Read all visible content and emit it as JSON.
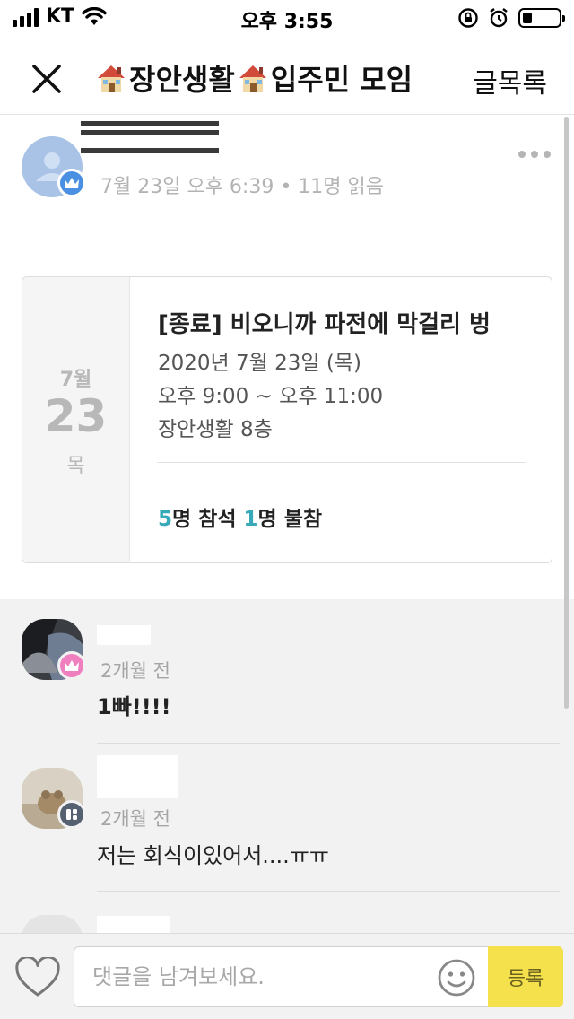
{
  "status_bar": {
    "carrier": "KT",
    "time": "오후 3:55",
    "icons": [
      "signal-icon",
      "wifi-icon",
      "rotation-lock-icon",
      "alarm-icon",
      "battery-icon"
    ]
  },
  "header": {
    "title": "장안생활",
    "title_part2": "입주민 모임",
    "list_button": "글목록",
    "icons": [
      "close-icon",
      "house-emoji-icon"
    ]
  },
  "post": {
    "meta": "7월 23일 오후 6:39 • 11명 읽음",
    "icons": [
      "user-avatar-icon",
      "crown-icon",
      "more-icon"
    ]
  },
  "event": {
    "month": "7월",
    "day": "23",
    "weekday": "목",
    "title": "[종료] 비오니까 파전에 막걸리 벙",
    "date_line": "2020년 7월 23일 (목)",
    "time_line": "오후 9:00 ~ 오후 11:00",
    "location_line": "장안생활 8층",
    "attend_count": "5",
    "attend_label": "명 참석 ",
    "absent_count": "1",
    "absent_label": "명 불참"
  },
  "comments": [
    {
      "time": "2개월 전",
      "text": "1빠!!!!"
    },
    {
      "time": "2개월 전",
      "text": "저는 회식이있어서....ㅠㅠ"
    }
  ],
  "comment_input": {
    "placeholder": "댓글을 남겨보세요.",
    "value": "",
    "submit_label": "등록",
    "icons": [
      "heart-icon",
      "emoji-icon"
    ]
  },
  "colors": {
    "accent_teal": "#37a9b8",
    "submit_yellow": "#f5e14b",
    "crown_blue": "#4a90e2",
    "crown_pink": "#f07fbf"
  }
}
